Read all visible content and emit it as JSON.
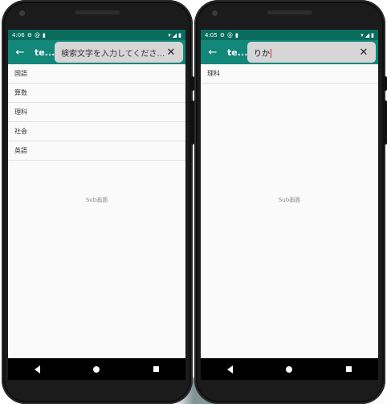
{
  "left": {
    "status": {
      "time": "4:06"
    },
    "appbar": {
      "title": "te..."
    },
    "search": {
      "placeholder": "検索文字を入力してくださいー"
    },
    "list": [
      "国語",
      "算数",
      "理科",
      "社会",
      "英語"
    ],
    "center_text": "Sub画面"
  },
  "right": {
    "status": {
      "time": "4:05"
    },
    "appbar": {
      "title": "te..."
    },
    "search": {
      "value": "りか"
    },
    "list": [
      "理科"
    ],
    "center_text": "Sub画面"
  },
  "icons": {
    "back": "arrow-left-icon",
    "close": "close-icon",
    "nav_back": "triangle-back-icon",
    "nav_home": "circle-home-icon",
    "nav_recent": "square-recent-icon"
  }
}
